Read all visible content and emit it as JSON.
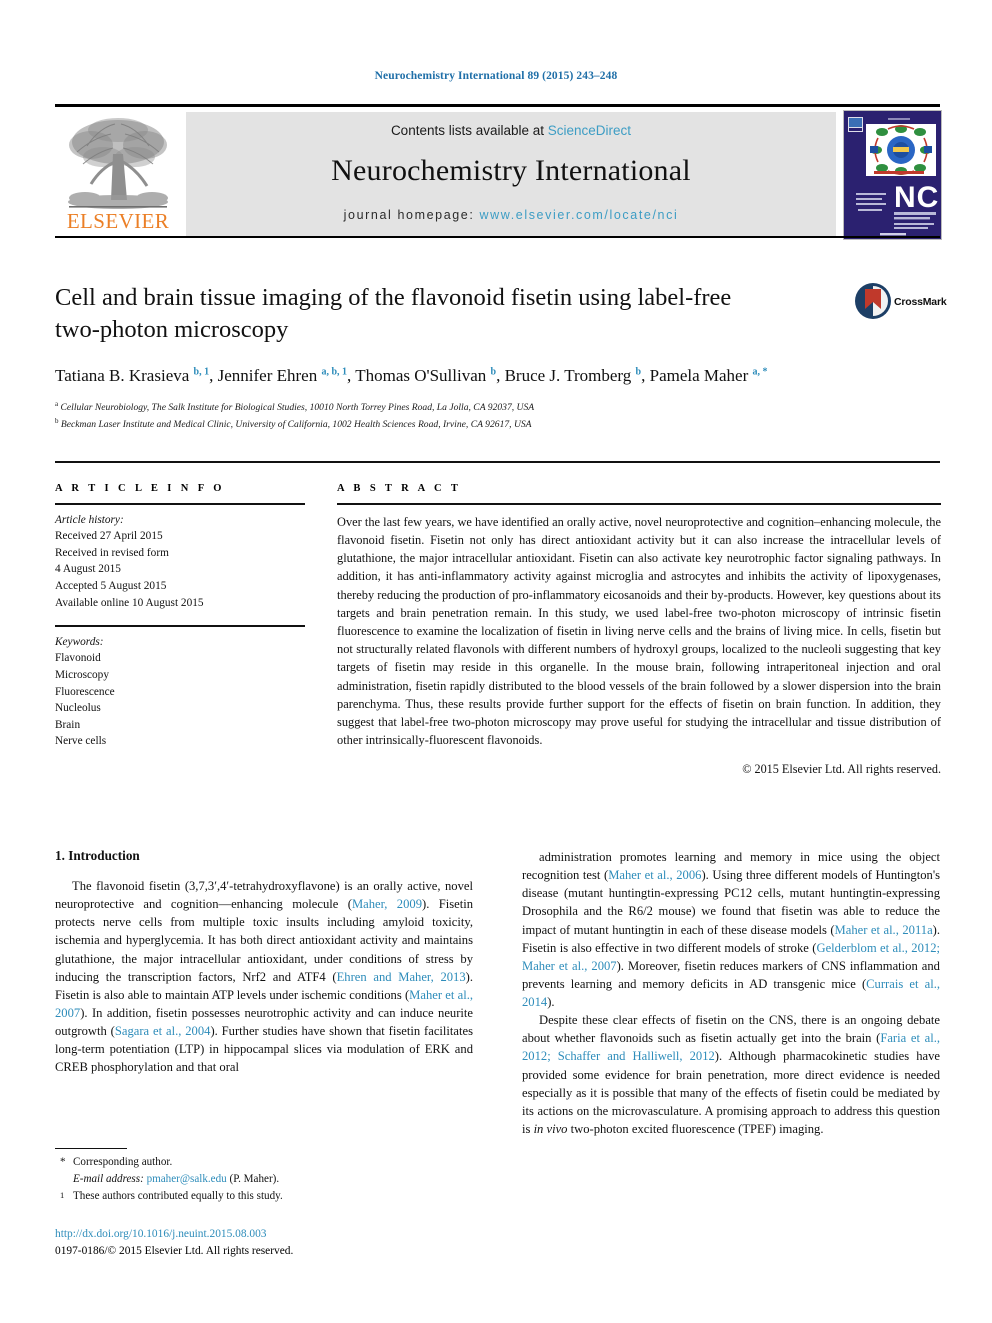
{
  "running_head": "Neurochemistry International 89 (2015) 243–248",
  "masthead": {
    "contents_prefix": "Contents lists available at ",
    "sciencedirect": "ScienceDirect",
    "journal_name": "Neurochemistry International",
    "homepage_prefix": "journal homepage: ",
    "homepage_url": "www.elsevier.com/locate/nci",
    "publisher_wordmark": "ELSEVIER",
    "cover_alt": "NCI",
    "colors": {
      "link_blue": "#3d9dc4",
      "elsevier_orange": "#eb7f26",
      "cover_navy": "#2b2170"
    }
  },
  "title": {
    "line1": "Cell and brain tissue imaging of the flavonoid fisetin using label-free",
    "line2": "two-photon microscopy",
    "crossmark_label": "CrossMark"
  },
  "authors": {
    "list": [
      {
        "name": "Tatiana B. Krasieva",
        "marks": "b, 1",
        "sep": ", "
      },
      {
        "name": "Jennifer Ehren",
        "marks": "a, b, 1",
        "sep": ", "
      },
      {
        "name": "Thomas O'Sullivan",
        "marks": "b",
        "sep": ", "
      },
      {
        "name": "Bruce J. Tromberg",
        "marks": "b",
        "sep": ", "
      },
      {
        "name": "Pamela Maher",
        "marks": "a, *",
        "sep": ""
      }
    ],
    "affiliations": [
      {
        "mark": "a",
        "text": "Cellular Neurobiology, The Salk Institute for Biological Studies, 10010 North Torrey Pines Road, La Jolla, CA 92037, USA"
      },
      {
        "mark": "b",
        "text": "Beckman Laser Institute and Medical Clinic, University of California, 1002 Health Sciences Road, Irvine, CA 92617, USA"
      }
    ]
  },
  "article_info": {
    "heading": "A R T I C L E   I N F O",
    "history_label": "Article history:",
    "history": [
      "Received 27 April 2015",
      "Received in revised form",
      "4 August 2015",
      "Accepted 5 August 2015",
      "Available online 10 August 2015"
    ],
    "keywords_label": "Keywords:",
    "keywords": [
      "Flavonoid",
      "Microscopy",
      "Fluorescence",
      "Nucleolus",
      "Brain",
      "Nerve cells"
    ]
  },
  "abstract": {
    "heading": "A B S T R A C T",
    "text": "Over the last few years, we have identified an orally active, novel neuroprotective and cognition–enhancing molecule, the flavonoid fisetin. Fisetin not only has direct antioxidant activity but it can also increase the intracellular levels of glutathione, the major intracellular antioxidant. Fisetin can also activate key neurotrophic factor signaling pathways. In addition, it has anti-inflammatory activity against microglia and astrocytes and inhibits the activity of lipoxygenases, thereby reducing the production of pro-inflammatory eicosanoids and their by-products. However, key questions about its targets and brain penetration remain. In this study, we used label-free two-photon microscopy of intrinsic fisetin fluorescence to examine the localization of fisetin in living nerve cells and the brains of living mice. In cells, fisetin but not structurally related flavonols with different numbers of hydroxyl groups, localized to the nucleoli suggesting that key targets of fisetin may reside in this organelle. In the mouse brain, following intraperitoneal injection and oral administration, fisetin rapidly distributed to the blood vessels of the brain followed by a slower dispersion into the brain parenchyma. Thus, these results provide further support for the effects of fisetin on brain function. In addition, they suggest that label-free two-photon microscopy may prove useful for studying the intracellular and tissue distribution of other intrinsically-fluorescent flavonoids.",
    "copyright": "© 2015 Elsevier Ltd. All rights reserved."
  },
  "body": {
    "section_heading": "1. Introduction",
    "left_paragraph_html": "The flavonoid fisetin (3,7,3′,4′-tetrahydroxyflavone) is an orally active, novel neuroprotective and cognition—enhancing molecule (<span class=\"lnk\">Maher, 2009</span>). Fisetin protects nerve cells from multiple toxic insults including amyloid toxicity, ischemia and hyperglycemia. It has both direct antioxidant activity and maintains glutathione, the major intracellular antioxidant, under conditions of stress by inducing the transcription factors, Nrf2 and ATF4 (<span class=\"lnk\">Ehren and Maher, 2013</span>). Fisetin is also able to maintain ATP levels under ischemic conditions (<span class=\"lnk\">Maher et al., 2007</span>). In addition, fisetin possesses neurotrophic activity and can induce neurite outgrowth (<span class=\"lnk\">Sagara et al., 2004</span>). Further studies have shown that fisetin facilitates long-term potentiation (LTP) in hippocampal slices via modulation of ERK and CREB phosphorylation and that oral",
    "right_paragraph_1_html": "administration promotes learning and memory in mice using the object recognition test (<span class=\"lnk\">Maher et al., 2006</span>). Using three different models of Huntington's disease (mutant huntingtin-expressing PC12 cells, mutant huntingtin-expressing Drosophila and the R6/2 mouse) we found that fisetin was able to reduce the impact of mutant huntingtin in each of these disease models (<span class=\"lnk\">Maher et al., 2011a</span>). Fisetin is also effective in two different models of stroke (<span class=\"lnk\">Gelderblom et al., 2012; Maher et al., 2007</span>). Moreover, fisetin reduces markers of CNS inflammation and prevents learning and memory deficits in AD transgenic mice (<span class=\"lnk\">Currais et al., 2014</span>).",
    "right_paragraph_2_html": "Despite these clear effects of fisetin on the CNS, there is an ongoing debate about whether flavonoids such as fisetin actually get into the brain (<span class=\"lnk\">Faria et al., 2012; Schaffer and Halliwell, 2012</span>). Although pharmacokinetic studies have provided some evidence for brain penetration, more direct evidence is needed especially as it is possible that many of the effects of fisetin could be mediated by its actions on the microvasculature. A promising approach to address this question is <i>in vivo</i> two-photon excited fluorescence (TPEF) imaging."
  },
  "footnotes": {
    "corresponding_mark": "*",
    "corresponding_text": "Corresponding author.",
    "email_label": "E-mail address:",
    "email": "pmaher@salk.edu",
    "email_suffix": "(P. Maher).",
    "equal_mark": "1",
    "equal_text": "These authors contributed equally to this study."
  },
  "footer": {
    "doi": "http://dx.doi.org/10.1016/j.neuint.2015.08.003",
    "issn_line": "0197-0186/© 2015 Elsevier Ltd. All rights reserved."
  }
}
